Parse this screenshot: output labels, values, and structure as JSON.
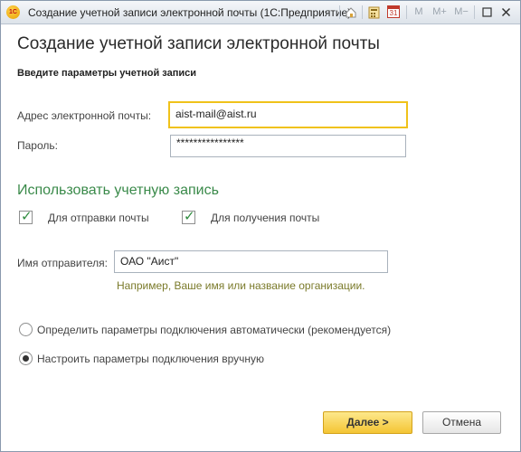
{
  "window": {
    "title": "Создание учетной записи электронной почты  (1С:Предприятие)",
    "app_icon_text": "1С",
    "toolbar": {
      "m": "M",
      "mplus": "M+",
      "mminus": "M−",
      "calendar_day": "31"
    }
  },
  "form": {
    "heading": "Создание учетной записи электронной почты",
    "subheading": "Введите параметры учетной записи",
    "email_label": "Адрес электронной почты:",
    "email_value": "aist-mail@aist.ru",
    "password_label": "Пароль:",
    "password_value": "****************",
    "use_section_title": "Использовать учетную запись",
    "send_checkbox_label": "Для отправки почты",
    "receive_checkbox_label": "Для получения почты",
    "sender_label": "Имя отправителя:",
    "sender_value": "ОАО \"Аист\"",
    "sender_hint": "Например, Ваше имя или название организации.",
    "auto_radio_label": "Определить параметры подключения автоматически (рекомендуется)",
    "manual_radio_label": "Настроить параметры подключения вручную",
    "send_checked": true,
    "receive_checked": true,
    "selected_radio": "manual"
  },
  "buttons": {
    "next": "Далее >",
    "cancel": "Отмена"
  },
  "colors": {
    "accent_green": "#3a8a4a",
    "focus_yellow": "#f0c21a",
    "primary_button": "#f4c534"
  }
}
